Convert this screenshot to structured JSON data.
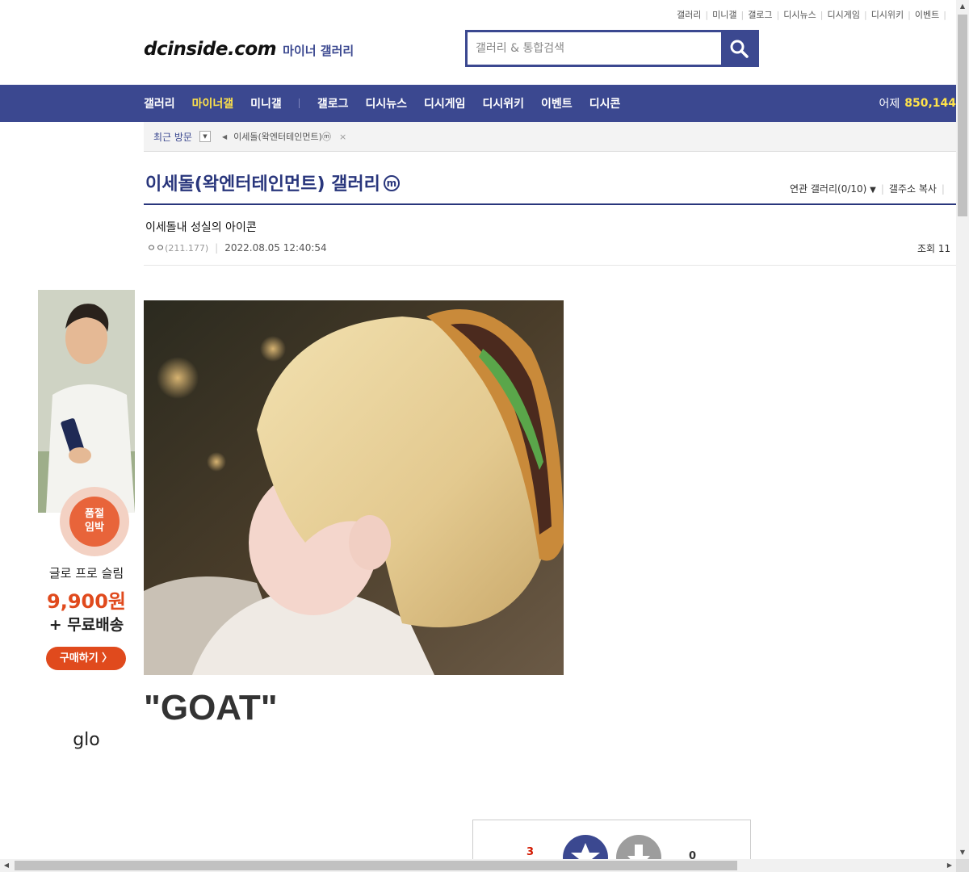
{
  "top_links": [
    "갤러리",
    "미니갤",
    "갤로그",
    "디시뉴스",
    "디시게임",
    "디시위키",
    "이벤트"
  ],
  "header": {
    "brand": "dcinside.com",
    "subtitle": "마이너 갤러리",
    "search_placeholder": "갤러리 & 통합검색",
    "search_icon": "search-icon"
  },
  "nav": {
    "items": [
      "갤러리",
      "마이너갤",
      "미니갤",
      "갤로그",
      "디시뉴스",
      "디시게임",
      "디시위키",
      "이벤트",
      "디시콘"
    ],
    "active_index": 1,
    "count_label": "어제",
    "count_value": "850,144"
  },
  "recent": {
    "label": "최근 방문",
    "item": "이세돌(왁엔터테인먼트)",
    "item_badge": "ⓜ",
    "close": "×"
  },
  "gallery": {
    "title": "이세돌(왁엔터테인먼트) 갤러리",
    "badge": "m",
    "related": "연관 갤러리(0/10)",
    "copy_address": "갤주소 복사"
  },
  "post": {
    "title": "이세돌내 성실의 아이콘",
    "author": "ㅇㅇ",
    "ip": "(211.177)",
    "date": "2022.08.05 12:40:54",
    "views_label": "조회 11",
    "body": "\"GOAT\""
  },
  "ad": {
    "badge": "품절\n임박",
    "line1": "글로 프로 슬림",
    "price": "9,900원",
    "line3": "+ 무료배송",
    "buy": "구매하기 〉",
    "logo": "glo"
  },
  "recommend": {
    "up_count": "3",
    "down_count": "0"
  },
  "colors": {
    "brand": "#3b4890",
    "active_nav": "#ffe34a",
    "ad_accent": "#e04a1d"
  }
}
